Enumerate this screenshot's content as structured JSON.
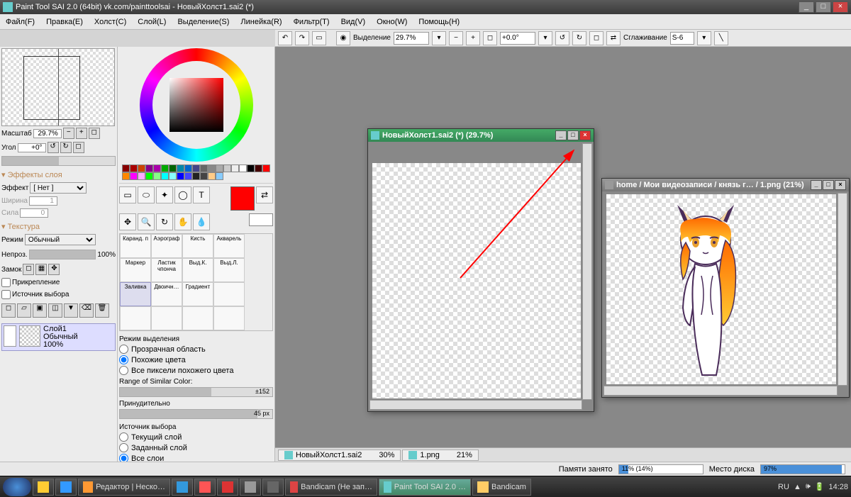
{
  "title": "Paint Tool SAI 2.0 (64bit) vk.com/painttoolsai - НовыйХолст1.sai2 (*)",
  "menu": [
    "Файл(F)",
    "Правка(E)",
    "Холст(C)",
    "Слой(L)",
    "Выделение(S)",
    "Линейка(R)",
    "Фильтр(T)",
    "Вид(V)",
    "Окно(W)",
    "Помощь(H)"
  ],
  "toolbar": {
    "selection": "Выделение",
    "zoom": "29.7%",
    "angle": "+0.0°",
    "smoothing_lbl": "Сглаживание",
    "smoothing": "S-6"
  },
  "left": {
    "scale_lbl": "Масштаб",
    "scale": "29.7%",
    "angle_lbl": "Угол",
    "angle": "+0°",
    "effects_h": "Эффекты слоя",
    "effect_lbl": "Эффект",
    "effect_val": "[ Нет ]",
    "width_lbl": "Ширина",
    "width_val": "1",
    "strength_lbl": "Сила",
    "strength_val": "0",
    "texture_h": "Текстура",
    "mode_lbl": "Режим",
    "mode_val": "Обычный",
    "opacity_lbl": "Непроз.",
    "opacity_val": "100%",
    "lock_lbl": "Замок",
    "clip_lbl": "Прикрепление",
    "source_lbl": "Источник выбора",
    "layer_name": "Слой1",
    "layer_mode": "Обычный",
    "layer_op": "100%"
  },
  "mid": {
    "brushes": [
      "Каранд. п",
      "Аэрограф",
      "Кисть",
      "Акварель",
      "Маркер",
      "Ластик чпонча",
      "Выд.К.",
      "Выд.Л.",
      "Заливка",
      "Двоичн…",
      "Градиент"
    ],
    "selmode_h": "Режим выделения",
    "sel_opts": [
      "Прозрачная область",
      "Похожие цвета",
      "Все пиксели похожего цвета"
    ],
    "range_lbl": "Range of Similar Color:",
    "range_val": "±152",
    "force_lbl": "Принудительно",
    "force_val": "45 px",
    "src_h": "Источник выбора",
    "src_opts": [
      "Текущий слой",
      "Заданный слой",
      "Все слои"
    ]
  },
  "doc1": {
    "title": "НовыйХолст1.sai2 (*) (29.7%)"
  },
  "doc2": {
    "title": "home / Мои видеозаписи / князь г… / 1.png (21%)"
  },
  "tabs": [
    {
      "name": "НовыйХолст1.sai2",
      "pct": "30%"
    },
    {
      "name": "1.png",
      "pct": "21%"
    }
  ],
  "status": {
    "mem_lbl": "Памяти занято",
    "mem": "11% (14%)",
    "disk_lbl": "Место диска",
    "disk": "97%"
  },
  "taskbar": [
    "Редактор | Неско…",
    "",
    "",
    "",
    "",
    "",
    "Bandicam (Не зап…",
    "Paint Tool SAI 2.0 …",
    "Bandicam"
  ],
  "tray": {
    "lang": "RU",
    "time": "14:28"
  },
  "swatch_colors": [
    "#800",
    "#a00",
    "#c40",
    "#808",
    "#a0a",
    "#0a0",
    "#060",
    "#08a",
    "#06c",
    "#448",
    "#666",
    "#888",
    "#aaa",
    "#ccc",
    "#eee",
    "#fff",
    "#000",
    "#400",
    "#f00",
    "#f80",
    "#f0f",
    "#faf",
    "#0f0",
    "#8f8",
    "#0ff",
    "#8ff",
    "#00f",
    "#44f",
    "#222",
    "#444",
    "#fc8",
    "#8cf"
  ]
}
